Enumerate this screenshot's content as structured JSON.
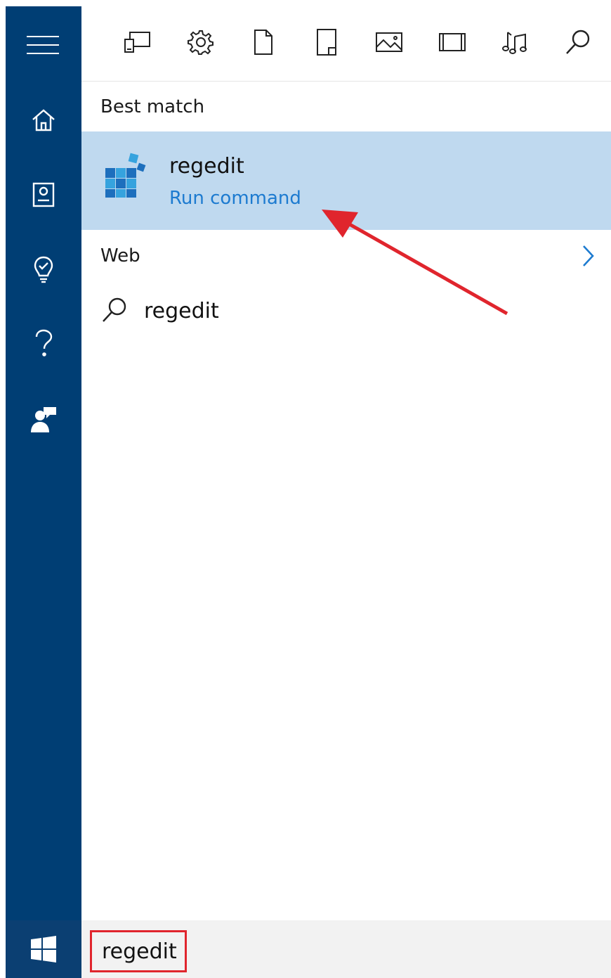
{
  "sidebar": {
    "items": [
      {
        "name": "menu",
        "icon": "hamburger-icon"
      },
      {
        "name": "home",
        "icon": "home-icon"
      },
      {
        "name": "notebook",
        "icon": "notebook-icon"
      },
      {
        "name": "reminders",
        "icon": "lightbulb-icon"
      },
      {
        "name": "help",
        "icon": "help-icon"
      },
      {
        "name": "feedback",
        "icon": "feedback-icon"
      }
    ],
    "start_icon": "windows-logo-icon",
    "background": "#003e74"
  },
  "filters": [
    {
      "name": "apps",
      "icon": "apps-icon"
    },
    {
      "name": "settings",
      "icon": "gear-icon"
    },
    {
      "name": "documents",
      "icon": "document-icon"
    },
    {
      "name": "folders",
      "icon": "folder-icon"
    },
    {
      "name": "photos",
      "icon": "photo-icon"
    },
    {
      "name": "videos",
      "icon": "video-icon"
    },
    {
      "name": "music",
      "icon": "music-icon"
    },
    {
      "name": "web",
      "icon": "search-icon"
    }
  ],
  "results": {
    "best_match_label": "Best match",
    "best_match": {
      "name": "regedit",
      "type": "Run command",
      "icon": "registry-editor-icon",
      "highlight_color": "#bfd9ef",
      "type_color": "#1d7bd0"
    },
    "web_label": "Web",
    "web_items": [
      {
        "text": "regedit",
        "icon": "search-icon"
      }
    ]
  },
  "search": {
    "value": "regedit",
    "highlight_color": "#e0252d"
  },
  "annotation": {
    "arrow_color": "#e0252d"
  }
}
